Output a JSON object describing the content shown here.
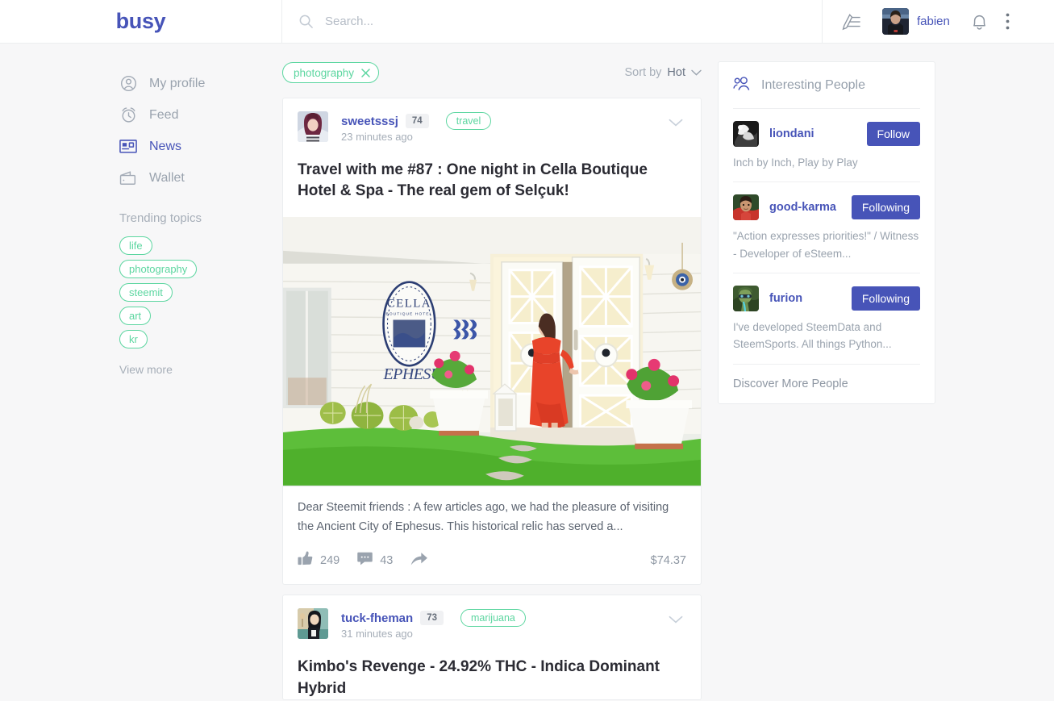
{
  "header": {
    "brand": "busy",
    "search_placeholder": "Search...",
    "search_value": "",
    "write_icon": "pen-write-icon",
    "username": "fabien",
    "bell_icon": "bell-icon",
    "more_icon": "vertical-dots-icon"
  },
  "sidebar": {
    "nav": [
      {
        "label": "My profile",
        "icon": "user-circle-icon",
        "active": false
      },
      {
        "label": "Feed",
        "icon": "clock-alarm-icon",
        "active": false
      },
      {
        "label": "News",
        "icon": "news-card-icon",
        "active": true
      },
      {
        "label": "Wallet",
        "icon": "wallet-icon",
        "active": false
      }
    ],
    "trending_title": "Trending topics",
    "trending_tags": [
      "life",
      "photography",
      "steemit",
      "art",
      "kr"
    ],
    "view_more": "View more"
  },
  "feed": {
    "active_filter": "photography",
    "sort_label": "Sort by",
    "sort_value": "Hot",
    "posts": [
      {
        "author": "sweetsssj",
        "reputation": "74",
        "tag": "travel",
        "time": "23 minutes ago",
        "title": "Travel with me #87 : One night in Cella Boutique Hotel & Spa - The real gem of Selçuk!",
        "body": "Dear Steemit friends : A few articles ago, we had the pleasure of visiting the Ancient City of Ephesus. This historical relic has served a...",
        "likes": "249",
        "comments": "43",
        "payout": "$74.37",
        "image_alt": "white boutique hotel entrance with woman in red dress, cacti and green lawn"
      },
      {
        "author": "tuck-fheman",
        "reputation": "73",
        "tag": "marijuana",
        "time": "31 minutes ago",
        "title": "Kimbo's Revenge - 24.92% THC - Indica Dominant Hybrid",
        "body": "",
        "likes": "",
        "comments": "",
        "payout": ""
      }
    ]
  },
  "interesting_people": {
    "title": "Interesting People",
    "icon": "people-group-icon",
    "people": [
      {
        "name": "liondani",
        "button": "Follow",
        "about": "Inch by Inch, Play by Play"
      },
      {
        "name": "good-karma",
        "button": "Following",
        "about": "\"Action expresses priorities!\" / Witness - Developer of eSteem..."
      },
      {
        "name": "furion",
        "button": "Following",
        "about": "I've developed SteemData and SteemSports. All things Python..."
      }
    ],
    "discover": "Discover More People"
  },
  "colors": {
    "brand": "#4754b8",
    "accent_green": "#5cd6a0",
    "page_bg": "#f7f7f8",
    "muted": "#9aa3ae",
    "title": "#2b2b33"
  }
}
